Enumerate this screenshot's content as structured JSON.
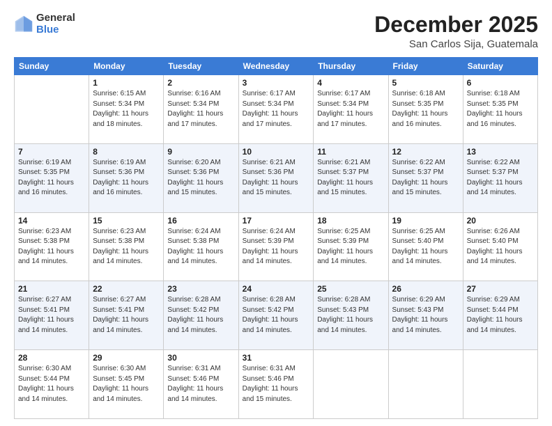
{
  "logo": {
    "general": "General",
    "blue": "Blue"
  },
  "header": {
    "month": "December 2025",
    "location": "San Carlos Sija, Guatemala"
  },
  "days_of_week": [
    "Sunday",
    "Monday",
    "Tuesday",
    "Wednesday",
    "Thursday",
    "Friday",
    "Saturday"
  ],
  "weeks": [
    [
      {
        "day": "",
        "sunrise": "",
        "sunset": "",
        "daylight": ""
      },
      {
        "day": "1",
        "sunrise": "Sunrise: 6:15 AM",
        "sunset": "Sunset: 5:34 PM",
        "daylight": "Daylight: 11 hours and 18 minutes."
      },
      {
        "day": "2",
        "sunrise": "Sunrise: 6:16 AM",
        "sunset": "Sunset: 5:34 PM",
        "daylight": "Daylight: 11 hours and 17 minutes."
      },
      {
        "day": "3",
        "sunrise": "Sunrise: 6:17 AM",
        "sunset": "Sunset: 5:34 PM",
        "daylight": "Daylight: 11 hours and 17 minutes."
      },
      {
        "day": "4",
        "sunrise": "Sunrise: 6:17 AM",
        "sunset": "Sunset: 5:34 PM",
        "daylight": "Daylight: 11 hours and 17 minutes."
      },
      {
        "day": "5",
        "sunrise": "Sunrise: 6:18 AM",
        "sunset": "Sunset: 5:35 PM",
        "daylight": "Daylight: 11 hours and 16 minutes."
      },
      {
        "day": "6",
        "sunrise": "Sunrise: 6:18 AM",
        "sunset": "Sunset: 5:35 PM",
        "daylight": "Daylight: 11 hours and 16 minutes."
      }
    ],
    [
      {
        "day": "7",
        "sunrise": "Sunrise: 6:19 AM",
        "sunset": "Sunset: 5:35 PM",
        "daylight": "Daylight: 11 hours and 16 minutes."
      },
      {
        "day": "8",
        "sunrise": "Sunrise: 6:19 AM",
        "sunset": "Sunset: 5:36 PM",
        "daylight": "Daylight: 11 hours and 16 minutes."
      },
      {
        "day": "9",
        "sunrise": "Sunrise: 6:20 AM",
        "sunset": "Sunset: 5:36 PM",
        "daylight": "Daylight: 11 hours and 15 minutes."
      },
      {
        "day": "10",
        "sunrise": "Sunrise: 6:21 AM",
        "sunset": "Sunset: 5:36 PM",
        "daylight": "Daylight: 11 hours and 15 minutes."
      },
      {
        "day": "11",
        "sunrise": "Sunrise: 6:21 AM",
        "sunset": "Sunset: 5:37 PM",
        "daylight": "Daylight: 11 hours and 15 minutes."
      },
      {
        "day": "12",
        "sunrise": "Sunrise: 6:22 AM",
        "sunset": "Sunset: 5:37 PM",
        "daylight": "Daylight: 11 hours and 15 minutes."
      },
      {
        "day": "13",
        "sunrise": "Sunrise: 6:22 AM",
        "sunset": "Sunset: 5:37 PM",
        "daylight": "Daylight: 11 hours and 14 minutes."
      }
    ],
    [
      {
        "day": "14",
        "sunrise": "Sunrise: 6:23 AM",
        "sunset": "Sunset: 5:38 PM",
        "daylight": "Daylight: 11 hours and 14 minutes."
      },
      {
        "day": "15",
        "sunrise": "Sunrise: 6:23 AM",
        "sunset": "Sunset: 5:38 PM",
        "daylight": "Daylight: 11 hours and 14 minutes."
      },
      {
        "day": "16",
        "sunrise": "Sunrise: 6:24 AM",
        "sunset": "Sunset: 5:38 PM",
        "daylight": "Daylight: 11 hours and 14 minutes."
      },
      {
        "day": "17",
        "sunrise": "Sunrise: 6:24 AM",
        "sunset": "Sunset: 5:39 PM",
        "daylight": "Daylight: 11 hours and 14 minutes."
      },
      {
        "day": "18",
        "sunrise": "Sunrise: 6:25 AM",
        "sunset": "Sunset: 5:39 PM",
        "daylight": "Daylight: 11 hours and 14 minutes."
      },
      {
        "day": "19",
        "sunrise": "Sunrise: 6:25 AM",
        "sunset": "Sunset: 5:40 PM",
        "daylight": "Daylight: 11 hours and 14 minutes."
      },
      {
        "day": "20",
        "sunrise": "Sunrise: 6:26 AM",
        "sunset": "Sunset: 5:40 PM",
        "daylight": "Daylight: 11 hours and 14 minutes."
      }
    ],
    [
      {
        "day": "21",
        "sunrise": "Sunrise: 6:27 AM",
        "sunset": "Sunset: 5:41 PM",
        "daylight": "Daylight: 11 hours and 14 minutes."
      },
      {
        "day": "22",
        "sunrise": "Sunrise: 6:27 AM",
        "sunset": "Sunset: 5:41 PM",
        "daylight": "Daylight: 11 hours and 14 minutes."
      },
      {
        "day": "23",
        "sunrise": "Sunrise: 6:28 AM",
        "sunset": "Sunset: 5:42 PM",
        "daylight": "Daylight: 11 hours and 14 minutes."
      },
      {
        "day": "24",
        "sunrise": "Sunrise: 6:28 AM",
        "sunset": "Sunset: 5:42 PM",
        "daylight": "Daylight: 11 hours and 14 minutes."
      },
      {
        "day": "25",
        "sunrise": "Sunrise: 6:28 AM",
        "sunset": "Sunset: 5:43 PM",
        "daylight": "Daylight: 11 hours and 14 minutes."
      },
      {
        "day": "26",
        "sunrise": "Sunrise: 6:29 AM",
        "sunset": "Sunset: 5:43 PM",
        "daylight": "Daylight: 11 hours and 14 minutes."
      },
      {
        "day": "27",
        "sunrise": "Sunrise: 6:29 AM",
        "sunset": "Sunset: 5:44 PM",
        "daylight": "Daylight: 11 hours and 14 minutes."
      }
    ],
    [
      {
        "day": "28",
        "sunrise": "Sunrise: 6:30 AM",
        "sunset": "Sunset: 5:44 PM",
        "daylight": "Daylight: 11 hours and 14 minutes."
      },
      {
        "day": "29",
        "sunrise": "Sunrise: 6:30 AM",
        "sunset": "Sunset: 5:45 PM",
        "daylight": "Daylight: 11 hours and 14 minutes."
      },
      {
        "day": "30",
        "sunrise": "Sunrise: 6:31 AM",
        "sunset": "Sunset: 5:46 PM",
        "daylight": "Daylight: 11 hours and 14 minutes."
      },
      {
        "day": "31",
        "sunrise": "Sunrise: 6:31 AM",
        "sunset": "Sunset: 5:46 PM",
        "daylight": "Daylight: 11 hours and 15 minutes."
      },
      {
        "day": "",
        "sunrise": "",
        "sunset": "",
        "daylight": ""
      },
      {
        "day": "",
        "sunrise": "",
        "sunset": "",
        "daylight": ""
      },
      {
        "day": "",
        "sunrise": "",
        "sunset": "",
        "daylight": ""
      }
    ]
  ]
}
